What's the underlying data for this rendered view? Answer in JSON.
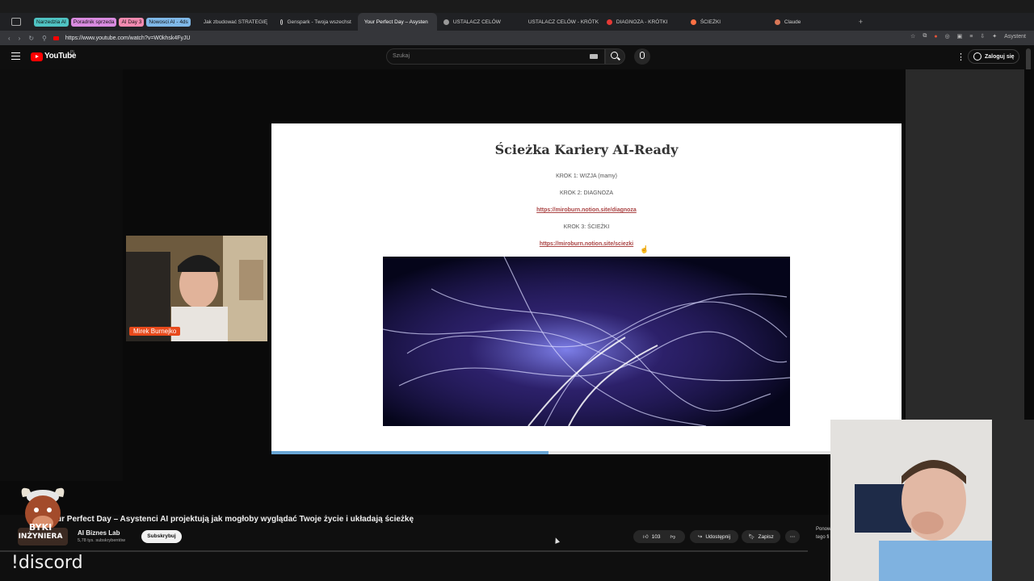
{
  "browser": {
    "tab_groups": [
      {
        "label": "Narzedzia AI",
        "color": "#4fc3c3"
      },
      {
        "label": "Poradnik sprzeda",
        "color": "#d98be0"
      },
      {
        "label": "AI Day 3",
        "color": "#f28ab0"
      },
      {
        "label": "Nowosci AI - 4ds",
        "color": "#7fb8e8"
      }
    ],
    "tabs": [
      {
        "label": "Jak zbudować STRATEGIĘ",
        "icon": "youtube-icon",
        "active": false
      },
      {
        "label": "Genspark - Twoja wszechst",
        "icon": "genspark-icon",
        "active": false
      },
      {
        "label": "Your Perfect Day – Asysten",
        "icon": "youtube-icon",
        "active": true
      },
      {
        "label": "USTALACZ CELÓW",
        "icon": "person-icon",
        "active": false
      },
      {
        "label": "USTALACZ CELÓW - KRÓTK",
        "icon": "notion-icon",
        "active": false
      },
      {
        "label": "DIAGNOZA - KRÓTKI",
        "icon": "pin-icon",
        "active": false
      },
      {
        "label": "ŚCIEŻKI",
        "icon": "fire-icon",
        "active": false
      },
      {
        "label": "Claude",
        "icon": "claude-icon",
        "active": false
      }
    ],
    "url": "https://www.youtube.com/watch?v=W0khsk4FyJU",
    "assistant_label": "Asystent"
  },
  "youtube": {
    "logo_text": "YouTube",
    "logo_suffix": "PL",
    "search_placeholder": "Szukaj",
    "signin_label": "Zaloguj się"
  },
  "slide": {
    "title": "Ścieżka Kariery AI-Ready",
    "step1": "KROK 1: WIZJA (mamy)",
    "step2": "KROK 2: DIAGNOZA",
    "link1": "https://miroburn.notion.site/diagnoza",
    "step3": "KROK 3: ŚCIEŻKI",
    "link2": "https://miroburn.notion.site/sciezki",
    "progress": 0.44
  },
  "webcam_left": {
    "name_tag": "Mirek Burnejko"
  },
  "video": {
    "title": "ur Perfect Day – Asystenci AI projektują jak mogłoby wyglądać Twoje życie i układają ścieżkę",
    "channel": "AI Biznes Lab",
    "subscribers": "5,78 tys. subskrybentów",
    "subscribe_label": "Subskrybuj",
    "likes": "103",
    "share_label": "Udostępnij",
    "save_label": "Zapisz",
    "reply_text_1": "Ponow",
    "reply_text_2": "tego fi"
  },
  "overlay": {
    "logo_top": "BYKI",
    "logo_bottom": "INŻYNIERA",
    "discord": "!discord"
  },
  "colors": {
    "accent_red": "#ff0000",
    "link_color": "#a44444",
    "progress_blue": "#69a6d6"
  }
}
